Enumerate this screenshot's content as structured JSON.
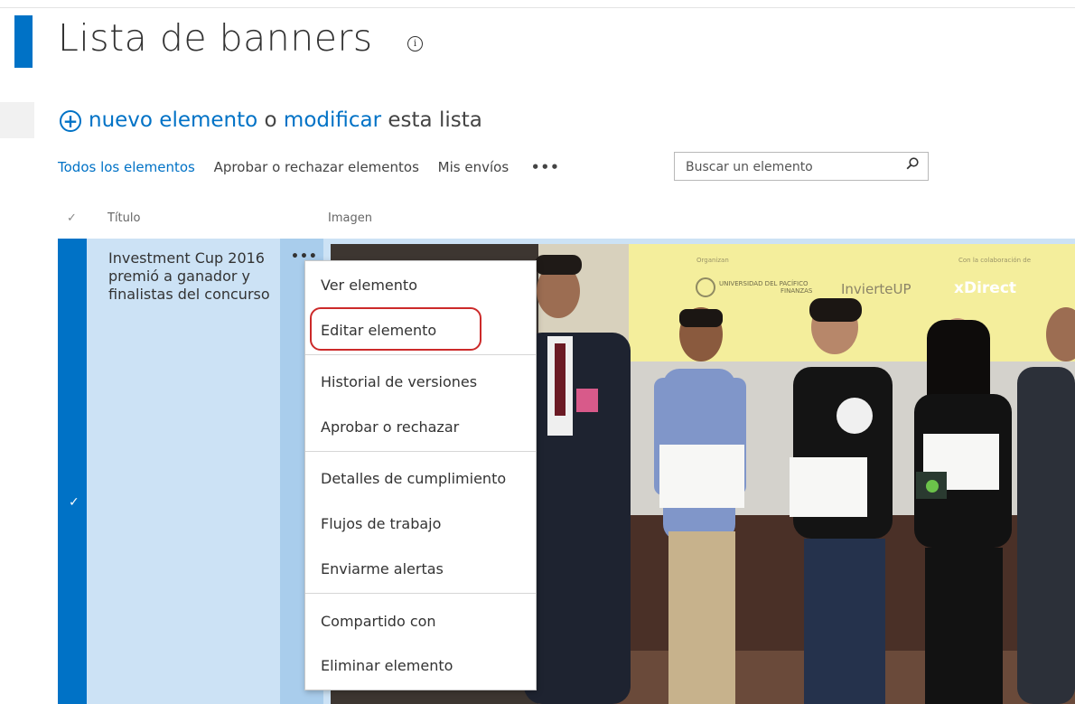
{
  "page": {
    "title": "Lista de banners",
    "info_glyph": "i"
  },
  "commands": {
    "new_item": "nuevo elemento",
    "or": "o",
    "modify": "modificar",
    "this_list": "esta lista"
  },
  "views": {
    "all_items": "Todos los elementos",
    "approve_reject": "Aprobar o rechazar elementos",
    "my_submissions": "Mis envíos",
    "more": "•••"
  },
  "search": {
    "placeholder": "Buscar un elemento",
    "icon": "search-icon"
  },
  "columns": {
    "check": "✓",
    "title": "Título",
    "image": "Imagen"
  },
  "row": {
    "check": "✓",
    "title": "Investment Cup 2016 premió a ganador y finalistas del concurso",
    "menu_dots": "•••"
  },
  "photo": {
    "logo_organizer": "UNIVERSIDAD DEL PACÍFICO",
    "logo_finanzas": "FINANZAS",
    "logo_invierte": "InvierteUP",
    "logo_xdirect": "xDirect",
    "small_left": "Organizan",
    "small_right": "Con la colaboración de"
  },
  "menu": {
    "items": [
      "Ver elemento",
      "Editar elemento",
      "Historial de versiones",
      "Aprobar o rechazar",
      "Detalles de cumplimiento",
      "Flujos de trabajo",
      "Enviarme alertas",
      "Compartido con",
      "Eliminar elemento"
    ]
  },
  "colors": {
    "accent": "#0072c6",
    "selected_row": "#cce2f5",
    "highlight": "#cc2a2a"
  }
}
